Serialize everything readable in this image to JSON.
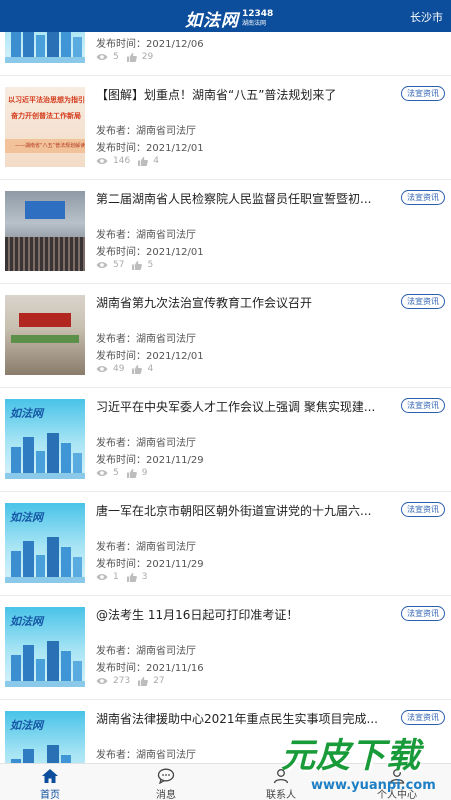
{
  "header": {
    "logo_main": "如法网",
    "logo_number": "12348",
    "logo_desc": "湖南法网",
    "city": "长沙市"
  },
  "colors": {
    "brand": "#0d4e9c",
    "tag": "#2a5fae",
    "watermark_green": "#1a9b3a"
  },
  "items": [
    {
      "title": "",
      "tag": "",
      "publisher": "",
      "time_label": "发布时间：",
      "time": "2021/12/06",
      "views": "5",
      "likes": "29",
      "thumb": "rufa-cityscape"
    },
    {
      "title": "【图解】划重点！湖南省“八五”普法规划来了",
      "tag": "法宣资讯",
      "publisher_label": "发布者：",
      "publisher": "湖南省司法厅",
      "time_label": "发布时间：",
      "time": "2021/12/01",
      "views": "146",
      "likes": "4",
      "thumb": "red-poster",
      "thumb_lines": [
        "以习近平法治思想为指引",
        "奋力开创普法工作新局",
        "——湖南省“八五”普法规划解读"
      ]
    },
    {
      "title": "第二届湖南省人民检察院人民监督员任职宣誓暨初...",
      "tag": "法宣资讯",
      "publisher_label": "发布者：",
      "publisher": "湖南省司法厅",
      "time_label": "发布时间：",
      "time": "2021/12/01",
      "views": "57",
      "likes": "5",
      "thumb": "meeting-hall"
    },
    {
      "title": "湖南省第九次法治宣传教育工作会议召开",
      "tag": "法宣资讯",
      "publisher_label": "发布者：",
      "publisher": "湖南省司法厅",
      "time_label": "发布时间：",
      "time": "2021/12/01",
      "views": "49",
      "likes": "4",
      "thumb": "conference-room"
    },
    {
      "title": "习近平在中央军委人才工作会议上强调 聚焦实现建...",
      "tag": "法宣资讯",
      "publisher_label": "发布者：",
      "publisher": "湖南省司法厅",
      "time_label": "发布时间：",
      "time": "2021/11/29",
      "views": "5",
      "likes": "9",
      "thumb": "rufa-cityscape"
    },
    {
      "title": "唐一军在北京市朝阳区朝外街道宣讲党的十九届六...",
      "tag": "法宣资讯",
      "publisher_label": "发布者：",
      "publisher": "湖南省司法厅",
      "time_label": "发布时间：",
      "time": "2021/11/29",
      "views": "1",
      "likes": "3",
      "thumb": "rufa-cityscape"
    },
    {
      "title": "@法考生 11月16日起可打印准考证！",
      "tag": "法宣资讯",
      "publisher_label": "发布者：",
      "publisher": "湖南省司法厅",
      "time_label": "发布时间：",
      "time": "2021/11/16",
      "views": "273",
      "likes": "27",
      "thumb": "rufa-cityscape"
    },
    {
      "title": "湖南省法律援助中心2021年重点民生实事项目完成...",
      "tag": "法宣资讯",
      "publisher_label": "发布者：",
      "publisher": "湖南省司法厅",
      "time_label": "",
      "time": "",
      "views": "",
      "likes": "",
      "thumb": "rufa-cityscape"
    }
  ],
  "tabbar": {
    "items": [
      {
        "label": "首页",
        "icon": "home-icon",
        "active": true
      },
      {
        "label": "消息",
        "icon": "chat-icon",
        "active": false
      },
      {
        "label": "联系人",
        "icon": "contacts-icon",
        "active": false
      },
      {
        "label": "个人中心",
        "icon": "user-icon",
        "active": false
      }
    ]
  },
  "watermark": {
    "text": "元皮下载",
    "url": "www.yuanpi.com"
  }
}
